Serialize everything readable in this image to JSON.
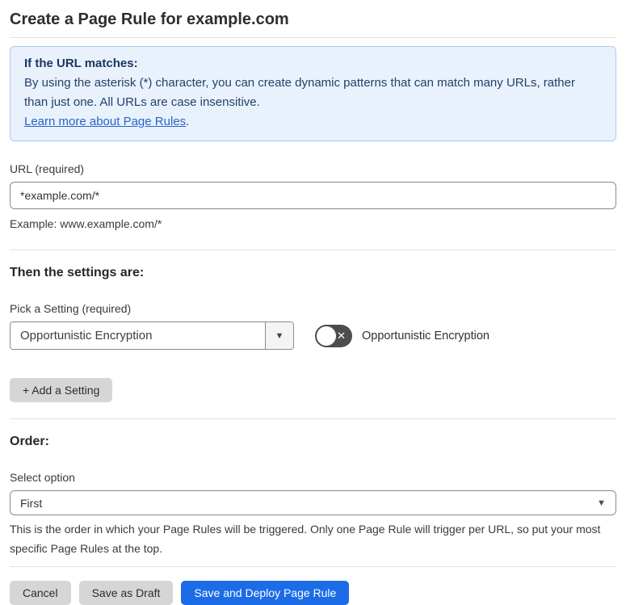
{
  "page": {
    "title": "Create a Page Rule for example.com"
  },
  "info_box": {
    "heading": "If the URL matches:",
    "body": "By using the asterisk (*) character, you can create dynamic patterns that can match many URLs, rather than just one. All URLs are case insensitive.",
    "link_label": "Learn more about Page Rules",
    "link_suffix": "."
  },
  "url_section": {
    "label": "URL (required)",
    "input_value": "*example.com/*",
    "helper": "Example: www.example.com/*"
  },
  "settings_section": {
    "heading": "Then the settings are:",
    "picker_label": "Pick a Setting (required)",
    "picker_value": "Opportunistic Encryption",
    "toggle_state": "off",
    "toggle_label": "Opportunistic Encryption",
    "add_button_label": "+ Add a Setting"
  },
  "order_section": {
    "heading": "Order:",
    "label": "Select option",
    "select_value": "First",
    "helper": "This is the order in which your Page Rules will be triggered. Only one Page Rule will trigger per URL, so put your most specific Page Rules at the top."
  },
  "footer": {
    "cancel_label": "Cancel",
    "save_draft_label": "Save as Draft",
    "save_deploy_label": "Save and Deploy Page Rule"
  },
  "icons": {
    "combobox_arrow": "▼",
    "select_chevron": "▼",
    "toggle_off_glyph": "✕"
  },
  "colors": {
    "primary_button_blue": "#1c6ce8",
    "info_box_background": "#e9f2fc",
    "info_box_border": "#abc9ef",
    "info_text_navy": "#24406b",
    "link_blue": "#2864c8",
    "toggle_off_gray": "#4d4d4d",
    "secondary_button_gray": "#d6d6d6"
  }
}
